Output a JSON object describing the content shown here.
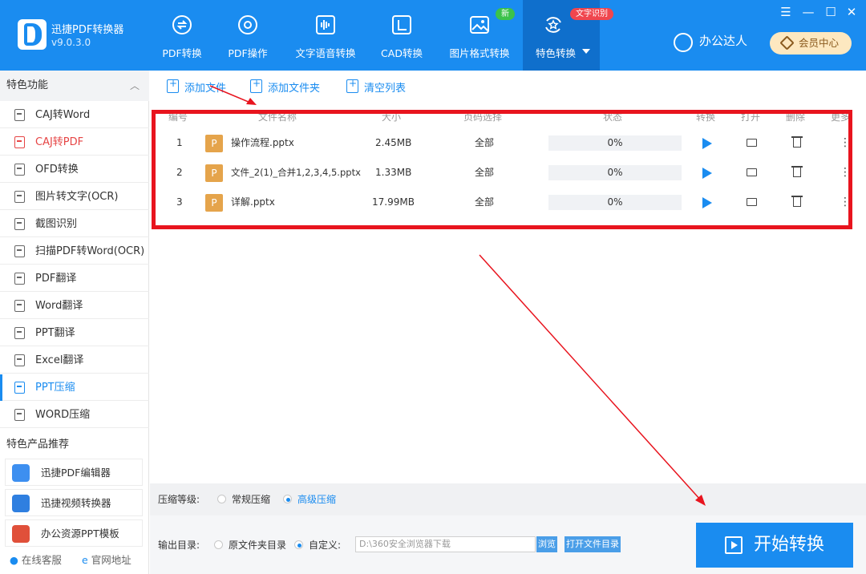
{
  "app": {
    "name": "迅捷PDF转换器",
    "version": "v9.0.3.0"
  },
  "nav": [
    {
      "label": "PDF转换"
    },
    {
      "label": "PDF操作"
    },
    {
      "label": "文字语音转换"
    },
    {
      "label": "CAD转换"
    },
    {
      "label": "图片格式转换"
    },
    {
      "label": "特色转换"
    }
  ],
  "badges": {
    "new": "新",
    "ocr": "文字识别"
  },
  "window": {
    "menu": "☰",
    "min": "—",
    "max": "☐",
    "close": "✕"
  },
  "user": {
    "name": "办公达人",
    "vip_label": "会员中心"
  },
  "sidebar": {
    "header": "特色功能",
    "items": [
      {
        "label": "CAJ转Word"
      },
      {
        "label": "CAJ转PDF"
      },
      {
        "label": "OFD转换"
      },
      {
        "label": "图片转文字(OCR)"
      },
      {
        "label": "截图识别"
      },
      {
        "label": "扫描PDF转Word(OCR)"
      },
      {
        "label": "PDF翻译"
      },
      {
        "label": "Word翻译"
      },
      {
        "label": "PPT翻译"
      },
      {
        "label": "Excel翻译"
      },
      {
        "label": "PPT压缩"
      },
      {
        "label": "WORD压缩"
      }
    ],
    "products_title": "特色产品推荐",
    "products": [
      {
        "label": "迅捷PDF编辑器"
      },
      {
        "label": "迅捷视频转换器"
      },
      {
        "label": "办公资源PPT模板"
      }
    ],
    "footer": {
      "support": "在线客服",
      "website": "官网地址"
    }
  },
  "toolbar": {
    "add_file": "添加文件",
    "add_folder": "添加文件夹",
    "clear_list": "清空列表"
  },
  "table": {
    "headers": {
      "index": "编号",
      "name": "文件名称",
      "size": "大小",
      "pages": "页码选择",
      "status": "状态",
      "convert": "转换",
      "open": "打开",
      "delete": "删除",
      "more": "更多"
    },
    "rows": [
      {
        "index": "1",
        "icon": "P",
        "name": "操作流程.pptx",
        "size": "2.45MB",
        "pages": "全部",
        "progress": "0%",
        "more": "⋮"
      },
      {
        "index": "2",
        "icon": "P",
        "name": "文件_2(1)_合并1,2,3,4,5.pptx",
        "size": "1.33MB",
        "pages": "全部",
        "progress": "0%",
        "more": "⋮"
      },
      {
        "index": "3",
        "icon": "P",
        "name": "详解.pptx",
        "size": "17.99MB",
        "pages": "全部",
        "progress": "0%",
        "more": "⋮"
      }
    ]
  },
  "compression": {
    "label": "压缩等级:",
    "normal": "常规压缩",
    "advanced": "高级压缩",
    "selected": "高级压缩"
  },
  "output": {
    "label": "输出目录:",
    "original": "原文件夹目录",
    "custom": "自定义:",
    "path": "D:\\360安全浏览器下载",
    "browse": "浏览",
    "open_dir": "打开文件目录"
  },
  "start_button": "开始转换",
  "colors": {
    "primary": "#1a8cf0",
    "highlight": "#e8141e",
    "ppt": "#e5a44b"
  }
}
